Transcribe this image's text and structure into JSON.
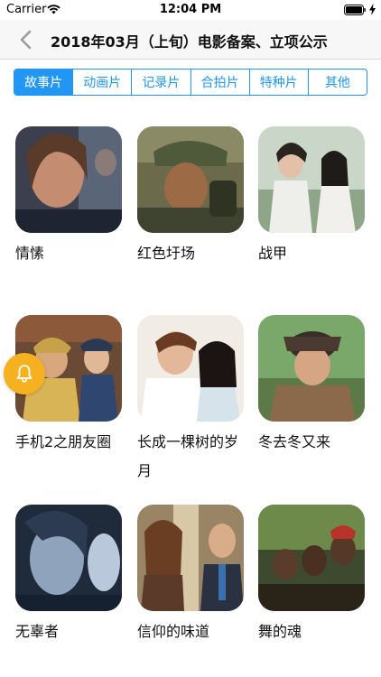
{
  "status_bar": {
    "carrier": "Carrier",
    "time": "12:04 PM",
    "wifi_icon": "wifi-icon",
    "battery_icon": "battery-icon",
    "charging_icon": "bolt-icon"
  },
  "nav": {
    "back_icon": "chevron-left-icon",
    "title": "2018年03月（上旬）电影备案、立项公示"
  },
  "tabs": [
    {
      "label": "故事片",
      "active": true
    },
    {
      "label": "动画片",
      "active": false
    },
    {
      "label": "记录片",
      "active": false
    },
    {
      "label": "合拍片",
      "active": false
    },
    {
      "label": "特种片",
      "active": false
    },
    {
      "label": "其他",
      "active": false
    }
  ],
  "movies": [
    {
      "title": "情愫"
    },
    {
      "title": "红色圩场"
    },
    {
      "title": "战甲"
    },
    {
      "title": "手机2之朋友圈"
    },
    {
      "title": "长成一棵树的岁月"
    },
    {
      "title": "冬去冬又来"
    },
    {
      "title": "无辜者"
    },
    {
      "title": "信仰的味道"
    },
    {
      "title": "舞的魂"
    }
  ],
  "floating_button": {
    "icon": "bell-icon"
  },
  "colors": {
    "accent": "#2196f3",
    "bell_bg": "#f5b120",
    "nav_bg": "#f7f7f7"
  }
}
